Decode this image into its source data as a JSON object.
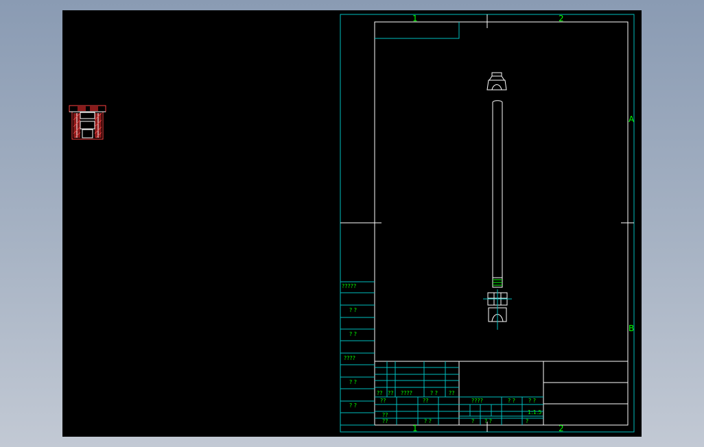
{
  "drawing_title": "",
  "colors": {
    "background": "#000000",
    "frame": "#ffffff",
    "grid": "#00c0c0",
    "text": "#00ff00",
    "section_part": "#ff4040",
    "hatch": "#aa2222"
  },
  "zones": {
    "col_1": "1",
    "col_2": "2",
    "row_a": "A",
    "row_b": "B"
  },
  "side_table": {
    "r1": "?????",
    "r2": "? ?",
    "r3": "? ?",
    "r4": "????",
    "r5": "? ?",
    "r6": "? ?"
  },
  "title_block": {
    "h1": "??",
    "h2": "??",
    "h3": "????",
    "h4": "? ?",
    "h5": "??",
    "a1": "??",
    "a2": "??",
    "a3": "????",
    "a4": "? ?",
    "a5": "? ?",
    "b1": "??",
    "b2": "??",
    "scale": "1:1.5",
    "c1": "? ?",
    "c2": "?",
    "c3": "? ?",
    "c4": "?"
  }
}
